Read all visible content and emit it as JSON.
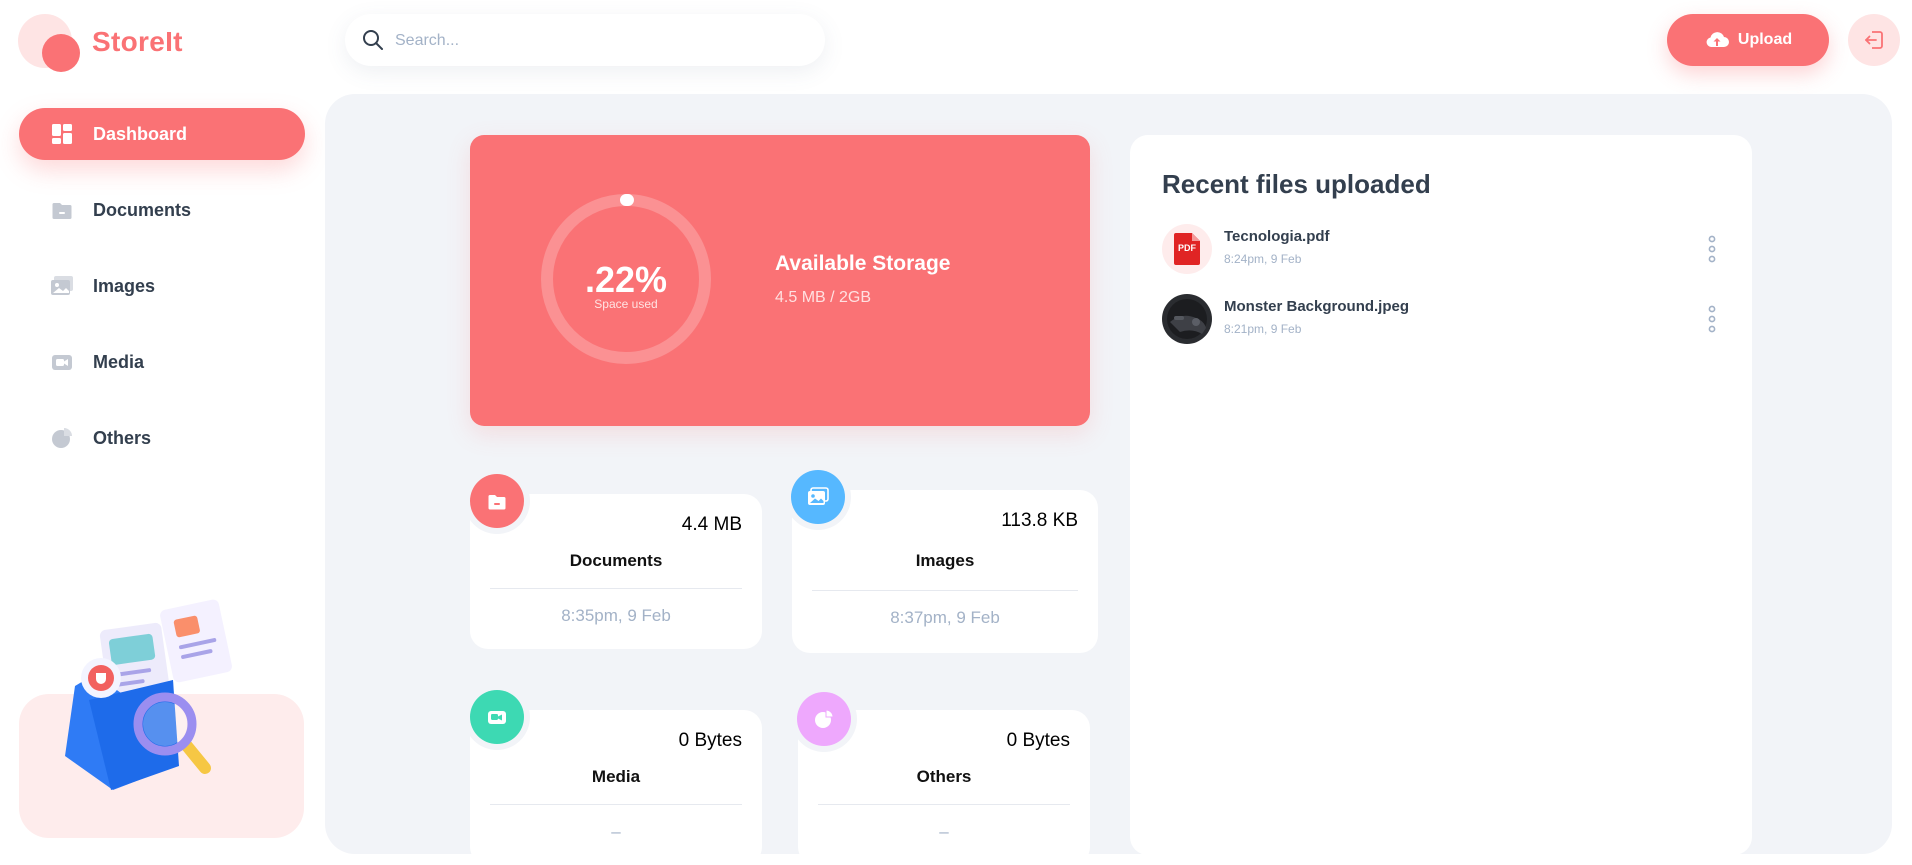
{
  "app": {
    "name": "StoreIt"
  },
  "search": {
    "placeholder": "Search..."
  },
  "header": {
    "upload_label": "Upload"
  },
  "sidebar": {
    "items": [
      {
        "label": "Dashboard",
        "icon": "dashboard-icon",
        "active": true
      },
      {
        "label": "Documents",
        "icon": "documents-icon"
      },
      {
        "label": "Images",
        "icon": "images-icon"
      },
      {
        "label": "Media",
        "icon": "media-icon"
      },
      {
        "label": "Others",
        "icon": "others-icon"
      }
    ]
  },
  "storage": {
    "percent_label": ".22%",
    "percent_used": 0.22,
    "caption": "Space used",
    "title": "Available Storage",
    "value": "4.5 MB / 2GB"
  },
  "summary": [
    {
      "name": "Documents",
      "size": "4.4 MB",
      "date": "8:35pm, 9 Feb",
      "icon": "document-icon",
      "color": "#FA7275"
    },
    {
      "name": "Images",
      "size": "113.8 KB",
      "date": "8:37pm, 9 Feb",
      "icon": "image-icon",
      "color": "#56B8FF"
    },
    {
      "name": "Media",
      "size": "0 Bytes",
      "date": "–",
      "icon": "video-icon",
      "color": "#3DD9B3"
    },
    {
      "name": "Others",
      "size": "0 Bytes",
      "date": "–",
      "icon": "pie-icon",
      "color": "#EEA8FD"
    }
  ],
  "recent": {
    "title": "Recent files uploaded",
    "files": [
      {
        "name": "Tecnologia.pdf",
        "date": "8:24pm, 9 Feb",
        "thumb": "pdf-icon",
        "thumb_text": "PDF"
      },
      {
        "name": "Monster Background.jpeg",
        "date": "8:21pm, 9 Feb",
        "thumb": "image-thumbnail"
      }
    ]
  },
  "colors": {
    "brand": "#FA7275",
    "brand_light": "#FEE4E4",
    "panel": "#F2F4F8",
    "text": "#333F4E",
    "muted": "#A3B2C7"
  }
}
